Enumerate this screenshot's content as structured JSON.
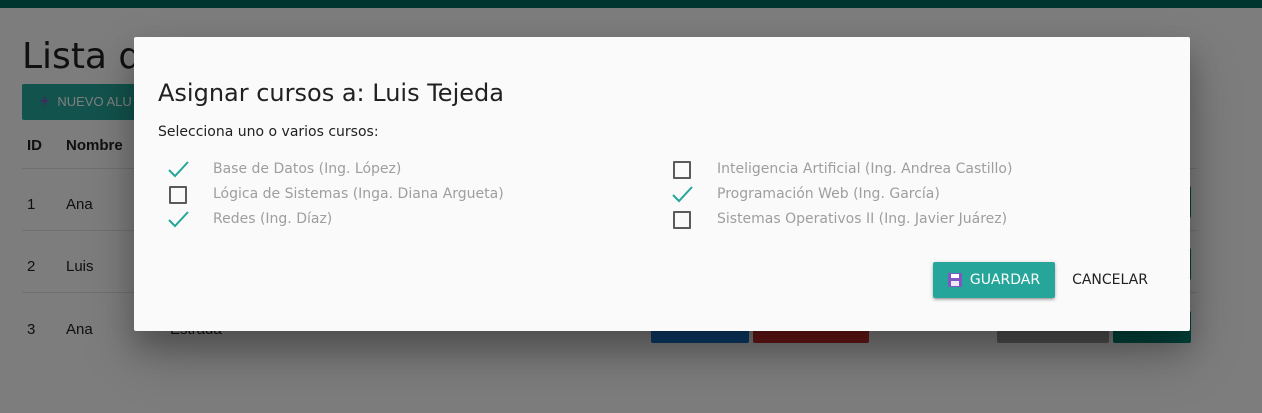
{
  "page": {
    "title": "Lista de",
    "new_button_label": "NUEVO ALU",
    "columns": [
      "ID",
      "Nombre"
    ],
    "rows": [
      {
        "id": "1",
        "nombre": "Ana"
      },
      {
        "id": "2",
        "nombre": "Luis"
      },
      {
        "id": "3",
        "nombre": "Ana",
        "apellido": "Estrada"
      }
    ]
  },
  "modal": {
    "title": "Asignar cursos a: Luis Tejeda",
    "subtitle": "Selecciona uno o varios cursos:",
    "courses": [
      {
        "label": "Base de Datos (Ing. López)",
        "checked": true
      },
      {
        "label": "Lógica de Sistemas (Inga. Diana Argueta)",
        "checked": false
      },
      {
        "label": "Redes (Ing. Díaz)",
        "checked": true
      },
      {
        "label": "Inteligencia Artificial (Ing. Andrea Castillo)",
        "checked": false
      },
      {
        "label": "Programación Web (Ing. García)",
        "checked": true
      },
      {
        "label": "Sistemas Operativos II (Ing. Javier Juárez)",
        "checked": false
      }
    ],
    "save_label": "GUARDAR",
    "cancel_label": "CANCELAR"
  },
  "colors": {
    "accent": "#26a69a",
    "topbar": "#00695c",
    "edit": "#1976d2",
    "delete": "#d32f2f"
  },
  "icons": {
    "save": "floppy-disk-icon",
    "checked": "check-icon",
    "unchecked": "checkbox-empty-icon",
    "add": "plus-icon"
  }
}
